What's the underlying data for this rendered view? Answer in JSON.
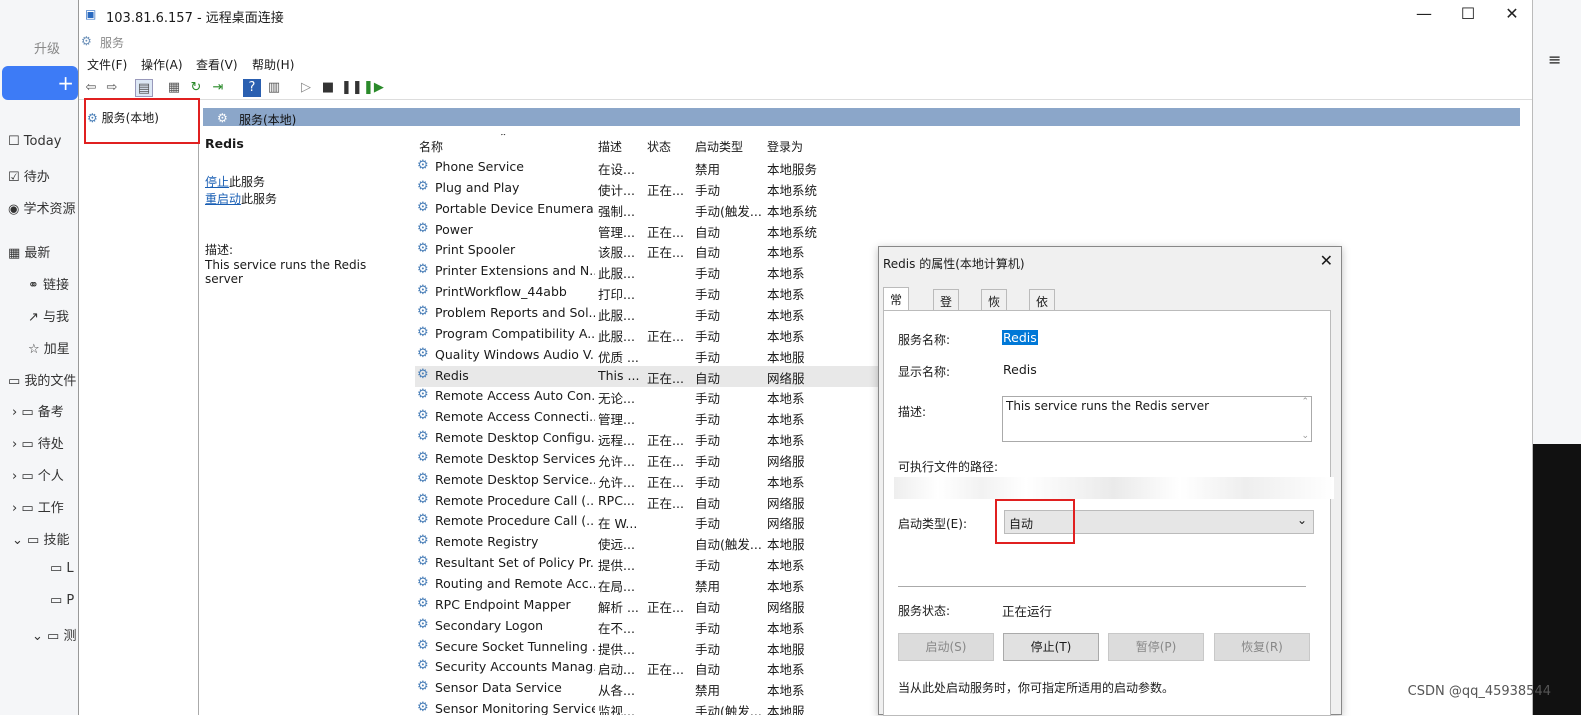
{
  "bg": {
    "upgrade": "升级",
    "plus": "+",
    "today": "Today",
    "todo": "待办",
    "academic": "学术资源",
    "recent": "最新",
    "link": "链接",
    "share": "与我",
    "star": "加星",
    "myfiles": "我的文件",
    "f1": "备考",
    "f2": "待处",
    "f3": "个人",
    "f4": "工作",
    "f5": "技能",
    "f6": "L",
    "f7": "P",
    "f8": "测",
    "sort_icon": "≡"
  },
  "rdp": {
    "title": "103.81.6.157 - 远程桌面连接",
    "min": "—",
    "max": "☐",
    "close": "✕",
    "app_caption": "服务",
    "menu": [
      "文件(F)",
      "操作(A)",
      "查看(V)",
      "帮助(H)"
    ],
    "tree_item": "服务(本地)",
    "header": "服务(本地)",
    "detail": {
      "name": "Redis",
      "stop": "停止",
      "stop_suffix": "此服务",
      "restart": "重启动",
      "restart_suffix": "此服务",
      "desc_label": "描述:",
      "desc": "This service runs the Redis server"
    },
    "columns": [
      "名称",
      "描述",
      "状态",
      "启动类型",
      "登录为"
    ],
    "rows": [
      {
        "name": "Phone Service",
        "desc": "在设...",
        "status": "",
        "start": "禁用",
        "logon": "本地服务"
      },
      {
        "name": "Plug and Play",
        "desc": "使计...",
        "status": "正在...",
        "start": "手动",
        "logon": "本地系统"
      },
      {
        "name": "Portable Device Enumera...",
        "desc": "强制...",
        "status": "",
        "start": "手动(触发...",
        "logon": "本地系统"
      },
      {
        "name": "Power",
        "desc": "管理...",
        "status": "正在...",
        "start": "自动",
        "logon": "本地系统"
      },
      {
        "name": "Print Spooler",
        "desc": "该服...",
        "status": "正在...",
        "start": "自动",
        "logon": "本地系"
      },
      {
        "name": "Printer Extensions and N...",
        "desc": "此服...",
        "status": "",
        "start": "手动",
        "logon": "本地系"
      },
      {
        "name": "PrintWorkflow_44abb",
        "desc": "打印...",
        "status": "",
        "start": "手动",
        "logon": "本地系"
      },
      {
        "name": "Problem Reports and Sol...",
        "desc": "此服...",
        "status": "",
        "start": "手动",
        "logon": "本地系"
      },
      {
        "name": "Program Compatibility A...",
        "desc": "此服...",
        "status": "正在...",
        "start": "手动",
        "logon": "本地系"
      },
      {
        "name": "Quality Windows Audio V...",
        "desc": "优质 ...",
        "status": "",
        "start": "手动",
        "logon": "本地服"
      },
      {
        "name": "Redis",
        "desc": "This ...",
        "status": "正在...",
        "start": "自动",
        "logon": "网络服"
      },
      {
        "name": "Remote Access Auto Con...",
        "desc": "无论...",
        "status": "",
        "start": "手动",
        "logon": "本地系"
      },
      {
        "name": "Remote Access Connecti...",
        "desc": "管理...",
        "status": "",
        "start": "手动",
        "logon": "本地系"
      },
      {
        "name": "Remote Desktop Configu...",
        "desc": "远程...",
        "status": "正在...",
        "start": "手动",
        "logon": "本地系"
      },
      {
        "name": "Remote Desktop Services",
        "desc": "允许...",
        "status": "正在...",
        "start": "手动",
        "logon": "网络服"
      },
      {
        "name": "Remote Desktop Service...",
        "desc": "允许...",
        "status": "正在...",
        "start": "手动",
        "logon": "本地系"
      },
      {
        "name": "Remote Procedure Call (...",
        "desc": "RPC...",
        "status": "正在...",
        "start": "自动",
        "logon": "网络服"
      },
      {
        "name": "Remote Procedure Call (...",
        "desc": "在 W...",
        "status": "",
        "start": "手动",
        "logon": "网络服"
      },
      {
        "name": "Remote Registry",
        "desc": "使远...",
        "status": "",
        "start": "自动(触发...",
        "logon": "本地服"
      },
      {
        "name": "Resultant Set of Policy Pr...",
        "desc": "提供...",
        "status": "",
        "start": "手动",
        "logon": "本地系"
      },
      {
        "name": "Routing and Remote Acc...",
        "desc": "在局...",
        "status": "",
        "start": "禁用",
        "logon": "本地系"
      },
      {
        "name": "RPC Endpoint Mapper",
        "desc": "解析 ...",
        "status": "正在...",
        "start": "自动",
        "logon": "网络服"
      },
      {
        "name": "Secondary Logon",
        "desc": "在不...",
        "status": "",
        "start": "手动",
        "logon": "本地系"
      },
      {
        "name": "Secure Socket Tunneling ...",
        "desc": "提供...",
        "status": "",
        "start": "手动",
        "logon": "本地服"
      },
      {
        "name": "Security Accounts Manag...",
        "desc": "启动...",
        "status": "正在...",
        "start": "自动",
        "logon": "本地系"
      },
      {
        "name": "Sensor Data Service",
        "desc": "从各...",
        "status": "",
        "start": "禁用",
        "logon": "本地系"
      },
      {
        "name": "Sensor Monitoring Service",
        "desc": "监视...",
        "status": "",
        "start": "手动(触发...",
        "logon": "本地服"
      }
    ],
    "selected_index": 10
  },
  "dialog": {
    "title": "Redis 的属性(本地计算机)",
    "close": "✕",
    "tabs": [
      "常规",
      "登录",
      "恢复",
      "依存关系"
    ],
    "svc_name_label": "服务名称:",
    "svc_name": "Redis",
    "display_label": "显示名称:",
    "display": "Redis",
    "desc_label": "描述:",
    "desc": "This service runs the Redis server",
    "path_label": "可执行文件的路径:",
    "start_type_label": "启动类型(E):",
    "start_type": "自动",
    "status_label": "服务状态:",
    "status": "正在运行",
    "buttons": [
      "启动(S)",
      "停止(T)",
      "暂停(P)",
      "恢复(R)"
    ],
    "hint": "当从此处启动服务时，你可指定所适用的启动参数。"
  },
  "watermark": "CSDN @qq_45938544"
}
